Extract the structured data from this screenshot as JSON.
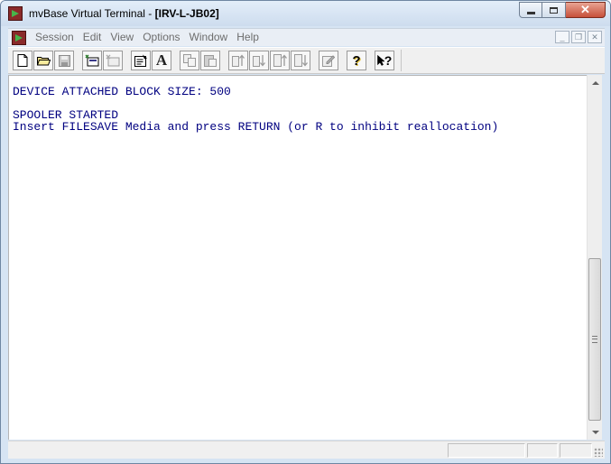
{
  "window": {
    "app_title": "mvBase Virtual Terminal - ",
    "document_title": "[IRV-L-JB02]"
  },
  "menu": {
    "items": [
      "Session",
      "Edit",
      "View",
      "Options",
      "Window",
      "Help"
    ]
  },
  "toolbar": {
    "buttons": [
      {
        "icon": "new-document-icon"
      },
      {
        "icon": "open-folder-icon"
      },
      {
        "icon": "save-disk-icon"
      },
      {
        "icon": "connect-icon"
      },
      {
        "icon": "disconnect-icon"
      },
      {
        "icon": "properties-icon"
      },
      {
        "icon": "font-icon",
        "label": "A"
      },
      {
        "icon": "copy-icon"
      },
      {
        "icon": "paste-icon"
      },
      {
        "icon": "send-file-icon"
      },
      {
        "icon": "receive-file-icon"
      },
      {
        "icon": "upload-icon"
      },
      {
        "icon": "download-icon"
      },
      {
        "icon": "edit-icon"
      },
      {
        "icon": "help-icon",
        "label": "?"
      },
      {
        "icon": "context-help-icon",
        "label": "?"
      }
    ]
  },
  "terminal": {
    "color": "#000080",
    "lines": [
      "DEVICE ATTACHED BLOCK SIZE: 500",
      "",
      "SPOOLER STARTED",
      "Insert FILESAVE Media and press RETURN (or R to inhibit reallocation)"
    ]
  },
  "scrollbar": {
    "position": 0.62
  }
}
